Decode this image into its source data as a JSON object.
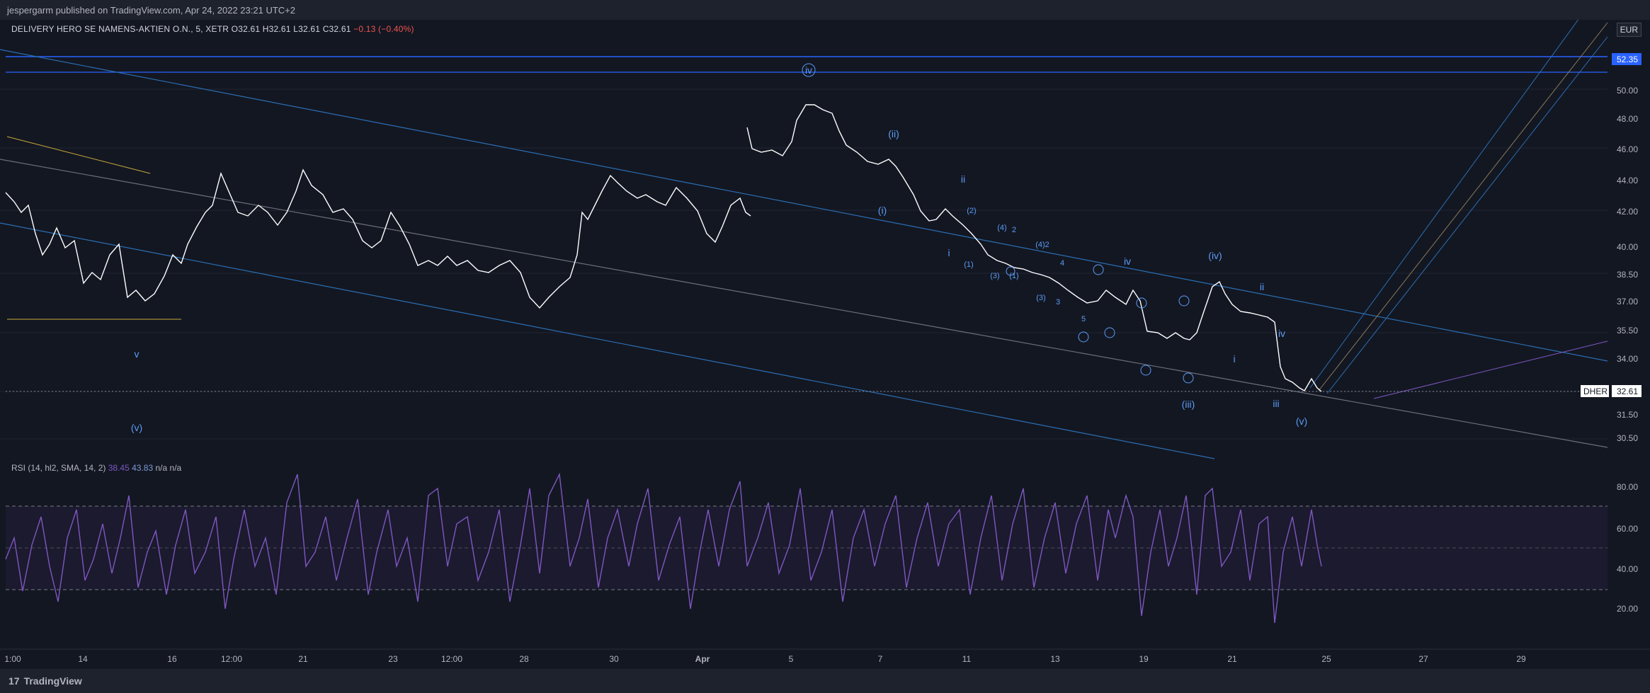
{
  "header": {
    "published_by": "jespergarm published on TradingView.com, Apr 24, 2022 23:21 UTC+2"
  },
  "legend": {
    "symbol": "DELIVERY HERO SE NAMENS-AKTIEN O.N., 5, XETR",
    "open": "O32.61",
    "high": "H32.61",
    "low": "L32.61",
    "close": "C32.61",
    "change": "−0.13 (−0.40%)"
  },
  "currency": "EUR",
  "price_axis": {
    "ticks": [
      "50.00",
      "48.00",
      "46.00",
      "44.00",
      "42.00",
      "40.00",
      "38.50",
      "37.00",
      "35.50",
      "34.00",
      "31.50",
      "30.50"
    ],
    "marker_top": "52.35",
    "symbol_tag": "DHER",
    "last_price": "32.61"
  },
  "rsi": {
    "label": "RSI (14, hl2, SMA, 14, 2)",
    "value1": "38.45",
    "value2": "43.83",
    "na1": "n/a",
    "na2": "n/a",
    "ticks": [
      "80.00",
      "60.00",
      "40.00",
      "20.00"
    ]
  },
  "time_axis": [
    "1:00",
    "14",
    "16",
    "12:00",
    "21",
    "23",
    "12:00",
    "28",
    "30",
    "Apr",
    "5",
    "7",
    "11",
    "13",
    "19",
    "21",
    "25",
    "27",
    "29"
  ],
  "wave_labels": [
    "iv",
    "(ii)",
    "ii",
    "(i)",
    "i",
    "(2)",
    "(4)",
    "2",
    "(4)2",
    "(1)",
    "(3)",
    "(3)",
    "(1)",
    "4",
    "3",
    "5",
    "iv",
    "(iv)",
    "ii",
    "v",
    "(v)",
    "i",
    "iv",
    "(iii)",
    "iii",
    "(v)"
  ],
  "footer": {
    "brand": "TradingView"
  },
  "colors": {
    "background": "#131722",
    "price": "#ffffff",
    "channel": "#2962ff",
    "rsi": "#7e57c2",
    "wave": "#5b9cf6"
  },
  "chart_data": {
    "type": "line",
    "title": "DELIVERY HERO SE NAMENS-AKTIEN O.N., 5, XETR",
    "x": [
      "1:00",
      "14",
      "16",
      "12:00",
      "21",
      "23",
      "12:00",
      "28",
      "30",
      "Apr",
      "5",
      "7",
      "11",
      "13",
      "19",
      "21",
      "25"
    ],
    "series": [
      {
        "values": [
          42.8,
          37.5,
          39.0,
          44.5,
          43.5,
          41.5,
          38.5,
          37.0,
          43.5,
          42.0,
          47.5,
          43.5,
          40.0,
          38.5,
          35.5,
          36.5,
          32.6
        ]
      }
    ],
    "ylim": [
      30.0,
      52.5
    ]
  }
}
